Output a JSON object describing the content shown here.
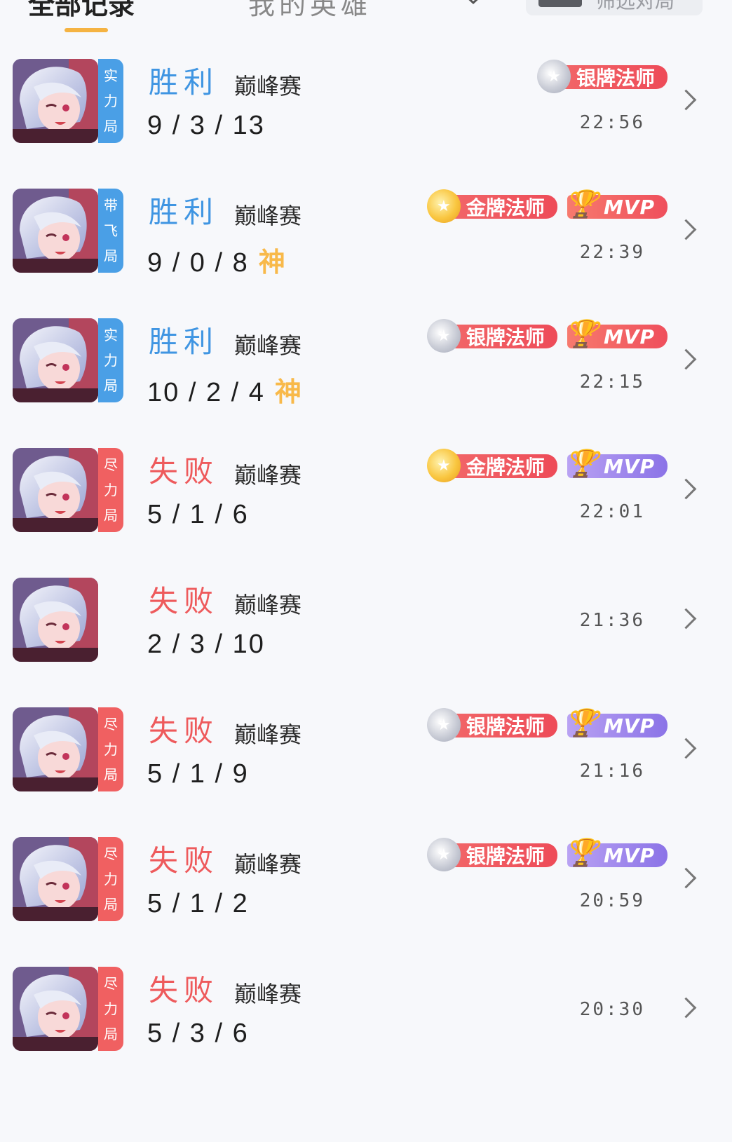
{
  "header": {
    "tab_active": "全部记录",
    "tab_other": "我的英雄",
    "filter_label": "筛选对局"
  },
  "matches": [
    {
      "result": "胜利",
      "result_type": "win",
      "mode": "巅峰赛",
      "kda": "9 / 3 / 13",
      "shen": "",
      "tag": [
        "实",
        "力",
        "局"
      ],
      "tag_color": "blue",
      "badges": [
        {
          "kind": "rank",
          "medal": "silver",
          "label": "银牌法师"
        }
      ],
      "time": "22:56"
    },
    {
      "result": "胜利",
      "result_type": "win",
      "mode": "巅峰赛",
      "kda": "9 / 0 / 8",
      "shen": "神",
      "tag": [
        "带",
        "飞",
        "局"
      ],
      "tag_color": "blue",
      "badges": [
        {
          "kind": "rank",
          "medal": "gold",
          "label": "金牌法师"
        },
        {
          "kind": "mvp",
          "color": "red",
          "label": "MVP"
        }
      ],
      "time": "22:39"
    },
    {
      "result": "胜利",
      "result_type": "win",
      "mode": "巅峰赛",
      "kda": "10 / 2 / 4",
      "shen": "神",
      "tag": [
        "实",
        "力",
        "局"
      ],
      "tag_color": "blue",
      "badges": [
        {
          "kind": "rank",
          "medal": "silver",
          "label": "银牌法师"
        },
        {
          "kind": "mvp",
          "color": "red",
          "label": "MVP"
        }
      ],
      "time": "22:15"
    },
    {
      "result": "失败",
      "result_type": "lose",
      "mode": "巅峰赛",
      "kda": "5 / 1 / 6",
      "shen": "",
      "tag": [
        "尽",
        "力",
        "局"
      ],
      "tag_color": "red",
      "badges": [
        {
          "kind": "rank",
          "medal": "gold",
          "label": "金牌法师"
        },
        {
          "kind": "mvp",
          "color": "purple",
          "label": "MVP"
        }
      ],
      "time": "22:01"
    },
    {
      "result": "失败",
      "result_type": "lose",
      "mode": "巅峰赛",
      "kda": "2 / 3 / 10",
      "shen": "",
      "tag": [],
      "tag_color": "",
      "badges": [],
      "time": "21:36"
    },
    {
      "result": "失败",
      "result_type": "lose",
      "mode": "巅峰赛",
      "kda": "5 / 1 / 9",
      "shen": "",
      "tag": [
        "尽",
        "力",
        "局"
      ],
      "tag_color": "red",
      "badges": [
        {
          "kind": "rank",
          "medal": "silver",
          "label": "银牌法师"
        },
        {
          "kind": "mvp",
          "color": "purple",
          "label": "MVP"
        }
      ],
      "time": "21:16"
    },
    {
      "result": "失败",
      "result_type": "lose",
      "mode": "巅峰赛",
      "kda": "5 / 1 / 2",
      "shen": "",
      "tag": [
        "尽",
        "力",
        "局"
      ],
      "tag_color": "red",
      "badges": [
        {
          "kind": "rank",
          "medal": "silver",
          "label": "银牌法师"
        },
        {
          "kind": "mvp",
          "color": "purple",
          "label": "MVP"
        }
      ],
      "time": "20:59"
    },
    {
      "result": "失败",
      "result_type": "lose",
      "mode": "巅峰赛",
      "kda": "5 / 3 / 6",
      "shen": "",
      "tag": [
        "尽",
        "力",
        "局"
      ],
      "tag_color": "red",
      "badges": [],
      "time": "20:30"
    }
  ],
  "icons": {
    "chevron": "chevron-right-icon",
    "medal": "medal-icon",
    "trophy": "trophy-icon",
    "dropdown": "chevron-down-icon"
  }
}
